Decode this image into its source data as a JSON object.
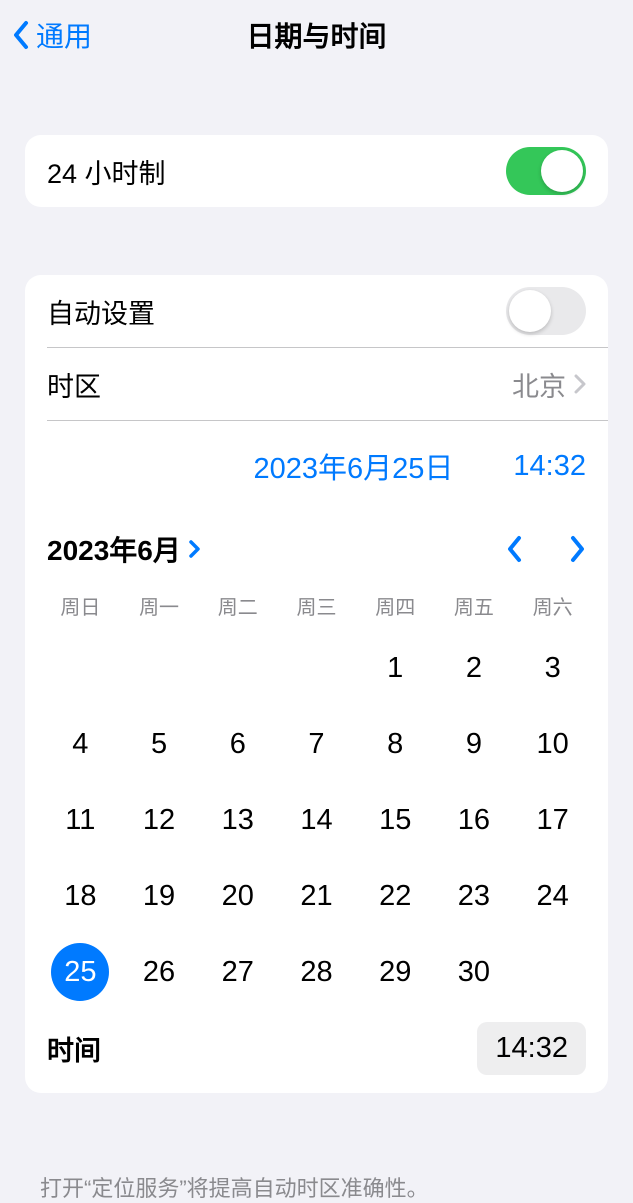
{
  "header": {
    "back_label": "通用",
    "title": "日期与时间"
  },
  "group1": {
    "twenty_four_hour_label": "24 小时制",
    "twenty_four_hour_on": true
  },
  "group2": {
    "auto_set_label": "自动设置",
    "auto_set_on": false,
    "timezone_label": "时区",
    "timezone_value": "北京",
    "selected_date": "2023年6月25日",
    "selected_time": "14:32",
    "calendar": {
      "month_label": "2023年6月",
      "weekdays": [
        "周日",
        "周一",
        "周二",
        "周三",
        "周四",
        "周五",
        "周六"
      ],
      "first_weekday_index": 4,
      "days_in_month": 30,
      "selected_day": 25
    },
    "time_row_label": "时间",
    "time_row_value": "14:32"
  },
  "footer_note": "打开“定位服务”将提高自动时区准确性。"
}
